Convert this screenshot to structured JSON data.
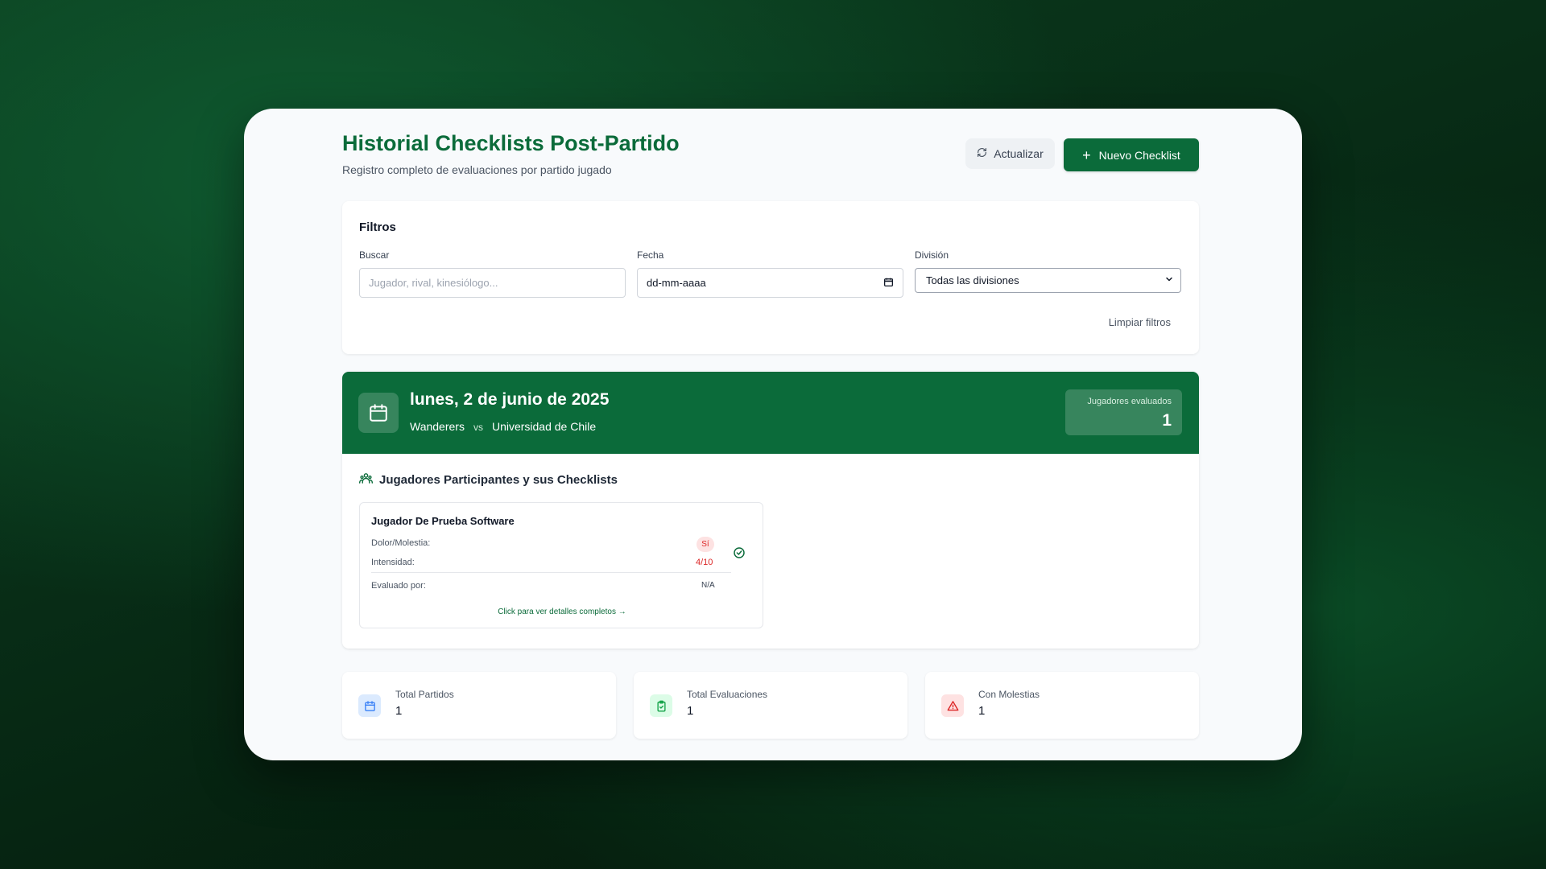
{
  "header": {
    "title": "Historial Checklists Post-Partido",
    "subtitle": "Registro completo de evaluaciones por partido jugado",
    "refresh_label": "Actualizar",
    "new_label": "Nuevo Checklist"
  },
  "filters": {
    "title": "Filtros",
    "search": {
      "label": "Buscar",
      "placeholder": "Jugador, rival, kinesiólogo..."
    },
    "date": {
      "label": "Fecha",
      "value": "dd-mm-aaaa"
    },
    "division": {
      "label": "División",
      "selected": "Todas las divisiones"
    },
    "clear_label": "Limpiar filtros"
  },
  "match": {
    "date": "lunes, 2 de junio de 2025",
    "home": "Wanderers",
    "vs": "vs",
    "away": "Universidad de Chile",
    "evaluated_label": "Jugadores evaluados",
    "evaluated_count": "1",
    "section_title": "Jugadores Participantes y sus Checklists",
    "players": [
      {
        "name": "Jugador De Prueba Software",
        "pain_label": "Dolor/Molestia:",
        "pain_value": "Sí",
        "intensity_label": "Intensidad:",
        "intensity_value": "4/10",
        "evaluator_label": "Evaluado por:",
        "evaluator_value": "N/A",
        "details_link": "Click para ver detalles completos →"
      }
    ]
  },
  "stats": [
    {
      "label": "Total Partidos",
      "value": "1",
      "icon": "calendar-icon",
      "color": "#3b82f6",
      "bg": "#dbeafe"
    },
    {
      "label": "Total Evaluaciones",
      "value": "1",
      "icon": "clipboard-check-icon",
      "color": "#16a34a",
      "bg": "#dcfce7"
    },
    {
      "label": "Con Molestias",
      "value": "1",
      "icon": "alert-triangle-icon",
      "color": "#dc2626",
      "bg": "#fee2e2"
    }
  ],
  "colors": {
    "primary": "#0b6b3a",
    "danger": "#dc2626"
  }
}
